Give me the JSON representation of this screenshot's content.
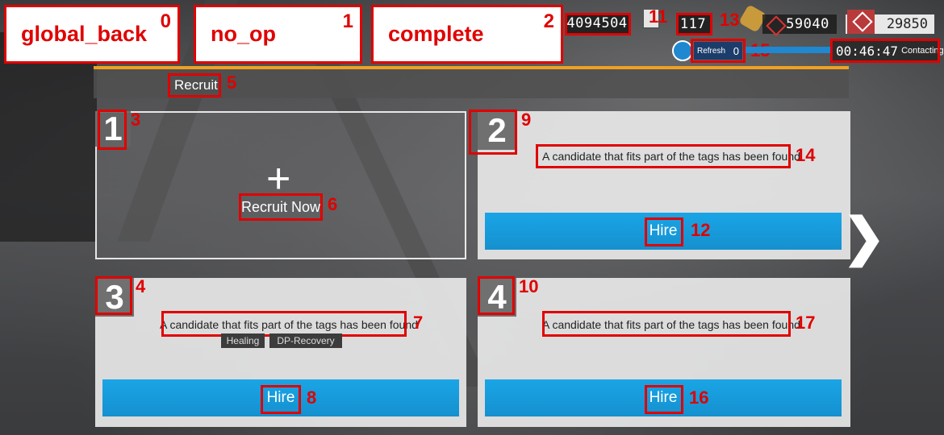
{
  "actions": [
    {
      "label": "global_back",
      "index": "0"
    },
    {
      "label": "no_op",
      "index": "1"
    },
    {
      "label": "complete",
      "index": "2"
    }
  ],
  "topbar": {
    "lmd": "4094504",
    "sanity_small": "117",
    "orundum": "59040",
    "originite": "29850",
    "refresh_label": "Refresh",
    "refresh_count": "0",
    "timer": "00:46:47",
    "status": "Contacting"
  },
  "title": "Recruit",
  "slots": [
    {
      "number": "1",
      "plus": "+",
      "action_label": "Recruit Now"
    },
    {
      "number": "2",
      "message": "A candidate that fits part of the tags has been found",
      "hire": "Hire"
    },
    {
      "number": "3",
      "message": "A candidate that fits part of the tags has been found",
      "tags": [
        "Healing",
        "DP-Recovery"
      ],
      "hire": "Hire"
    },
    {
      "number": "4",
      "message": "A candidate that fits part of the tags has been found",
      "hire": "Hire"
    }
  ],
  "annotations": [
    "0",
    "1",
    "2",
    "3",
    "4",
    "5",
    "6",
    "7",
    "8",
    "9",
    "10",
    "11",
    "12",
    "13",
    "14",
    "15",
    "16",
    "17"
  ],
  "chevron": "❯",
  "colors": {
    "hire_blue": "#1aa5e6",
    "accent_orange": "#f0a020",
    "annotation_red": "#e00000"
  }
}
